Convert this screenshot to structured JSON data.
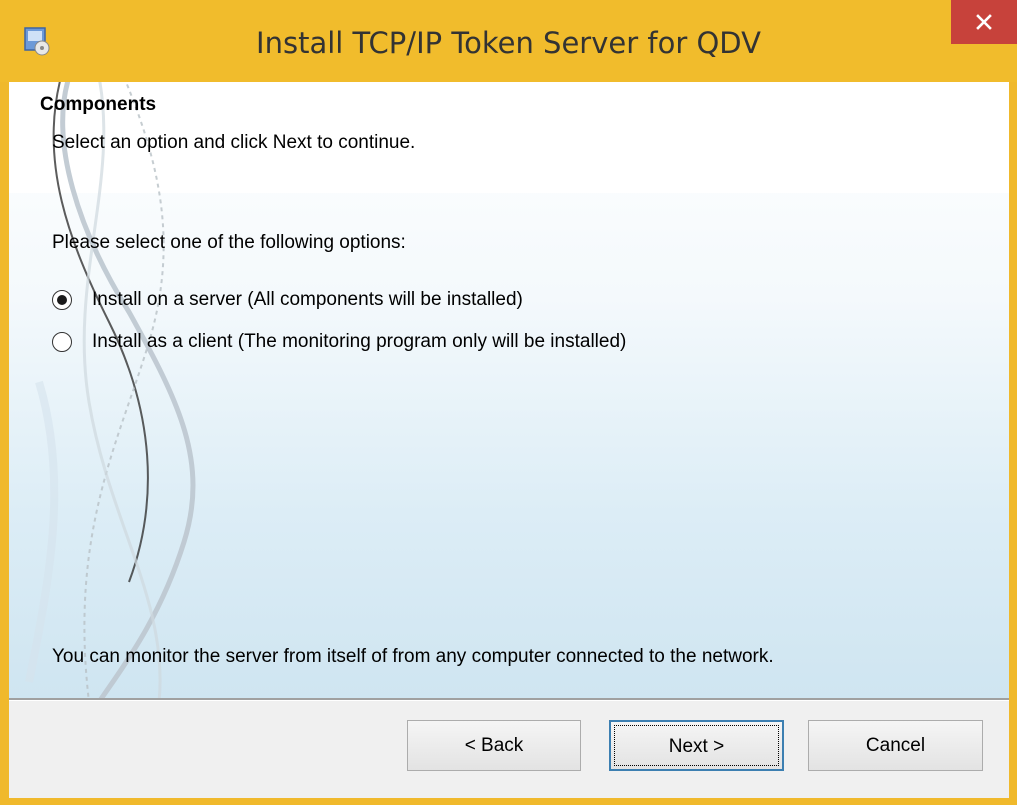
{
  "window": {
    "title": "Install TCP/IP Token Server for QDV",
    "close_label": "×"
  },
  "header": {
    "title": "Components",
    "subtitle": "Select an option and click Next to continue."
  },
  "body": {
    "prompt": "Please select one of the following options:",
    "options": [
      {
        "label": "Install on a server (All components will be installed)",
        "checked": true
      },
      {
        "label": "Install as a client (The monitoring program only will be installed)",
        "checked": false
      }
    ],
    "note": "You can monitor the server from itself of from any computer connected to the network."
  },
  "buttons": {
    "back_label": "< Back",
    "next_label": "Next >",
    "cancel_label": "Cancel"
  },
  "colors": {
    "titlebar": "#f1bc2c",
    "close_button": "#c7423b",
    "default_button_border": "#3c7fb1"
  }
}
